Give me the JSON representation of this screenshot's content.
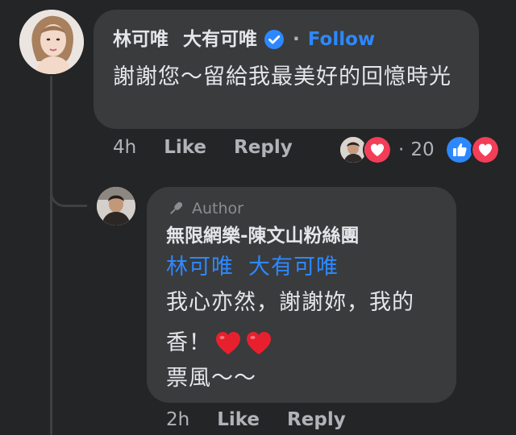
{
  "comment": {
    "author": "林可唯",
    "author_suffix": "大有可唯",
    "follow_separator": "·",
    "follow_label": "Follow",
    "text": "謝謝您～留給我最美好的回憶時光",
    "time": "4h",
    "like_label": "Like",
    "reply_label": "Reply",
    "reaction_separator": "·",
    "reaction_count": "20"
  },
  "reply": {
    "badge": "Author",
    "author": "無限網樂-陳文山粉絲團",
    "mention_first": "林可唯",
    "mention_second": "大有可唯",
    "line1": "我心亦然，謝謝妳，我的",
    "line2": "香！",
    "line3": "票風～～",
    "time": "2h",
    "like_label": "Like",
    "reply_label": "Reply"
  },
  "colors": {
    "background": "#242526",
    "bubble": "#3a3b3c",
    "accent_blue": "#2d88ff",
    "heart_red": "#f33e58",
    "muted_text": "#b0b3b8"
  },
  "icons": [
    "verified-badge-icon",
    "microphone-icon",
    "heart-icon",
    "like-thumb-icon"
  ]
}
